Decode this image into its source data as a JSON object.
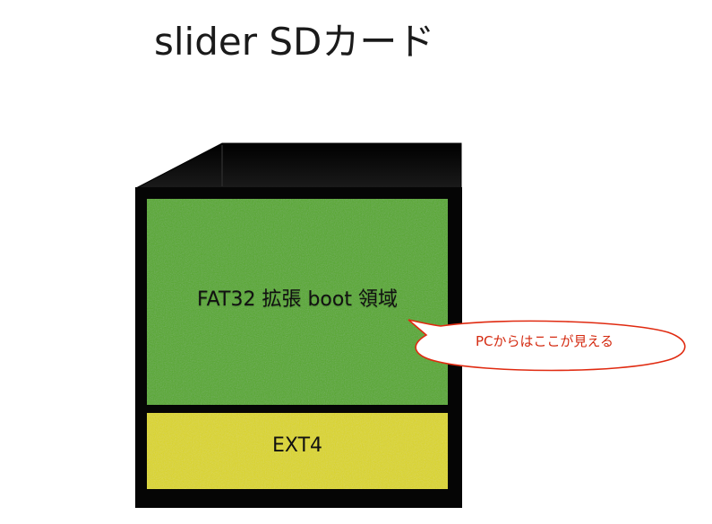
{
  "title": "slider SDカード",
  "partitions": {
    "fat": {
      "label": "FAT32 拡張 boot 領域",
      "color": "#55a825"
    },
    "ext": {
      "label": "EXT4",
      "color": "#dcd61e"
    }
  },
  "card_color": "#050505",
  "callout": {
    "text": "PCからはここが見える",
    "border_color": "#e02a10",
    "text_color": "#d42a10"
  }
}
